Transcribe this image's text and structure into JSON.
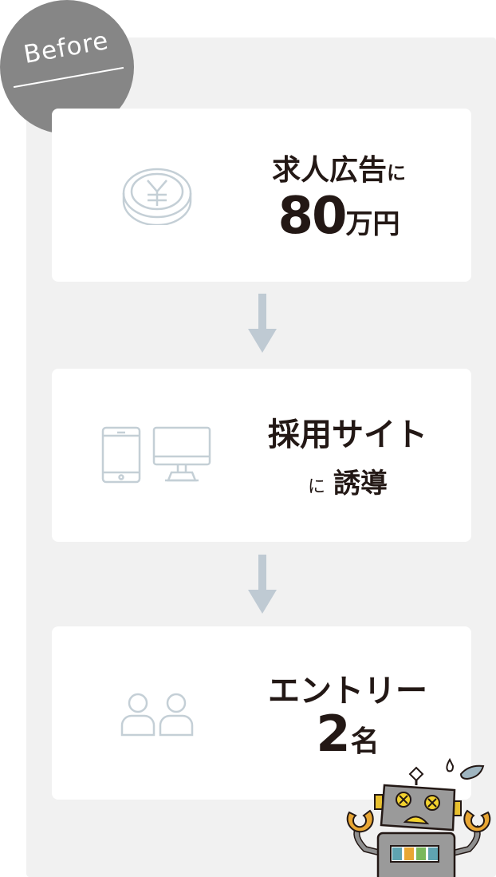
{
  "badge": {
    "label": "Before"
  },
  "steps": [
    {
      "line1": "求人広告",
      "line1_suffix": "に",
      "value": "80",
      "unit": "万円",
      "icon": "yen-coin-icon"
    },
    {
      "line1": "採用サイト",
      "prefix": "に",
      "line2": "誘導",
      "icon": "devices-icon"
    },
    {
      "line1": "エントリー",
      "value": "2",
      "unit": "名",
      "icon": "people-icon"
    }
  ],
  "colors": {
    "panel": "#f1f1f1",
    "badge": "#868686",
    "arrow": "#bfcad3",
    "icon": "#c4cfd6",
    "text": "#231815"
  },
  "mascot": {
    "icon": "confused-robot-icon"
  }
}
